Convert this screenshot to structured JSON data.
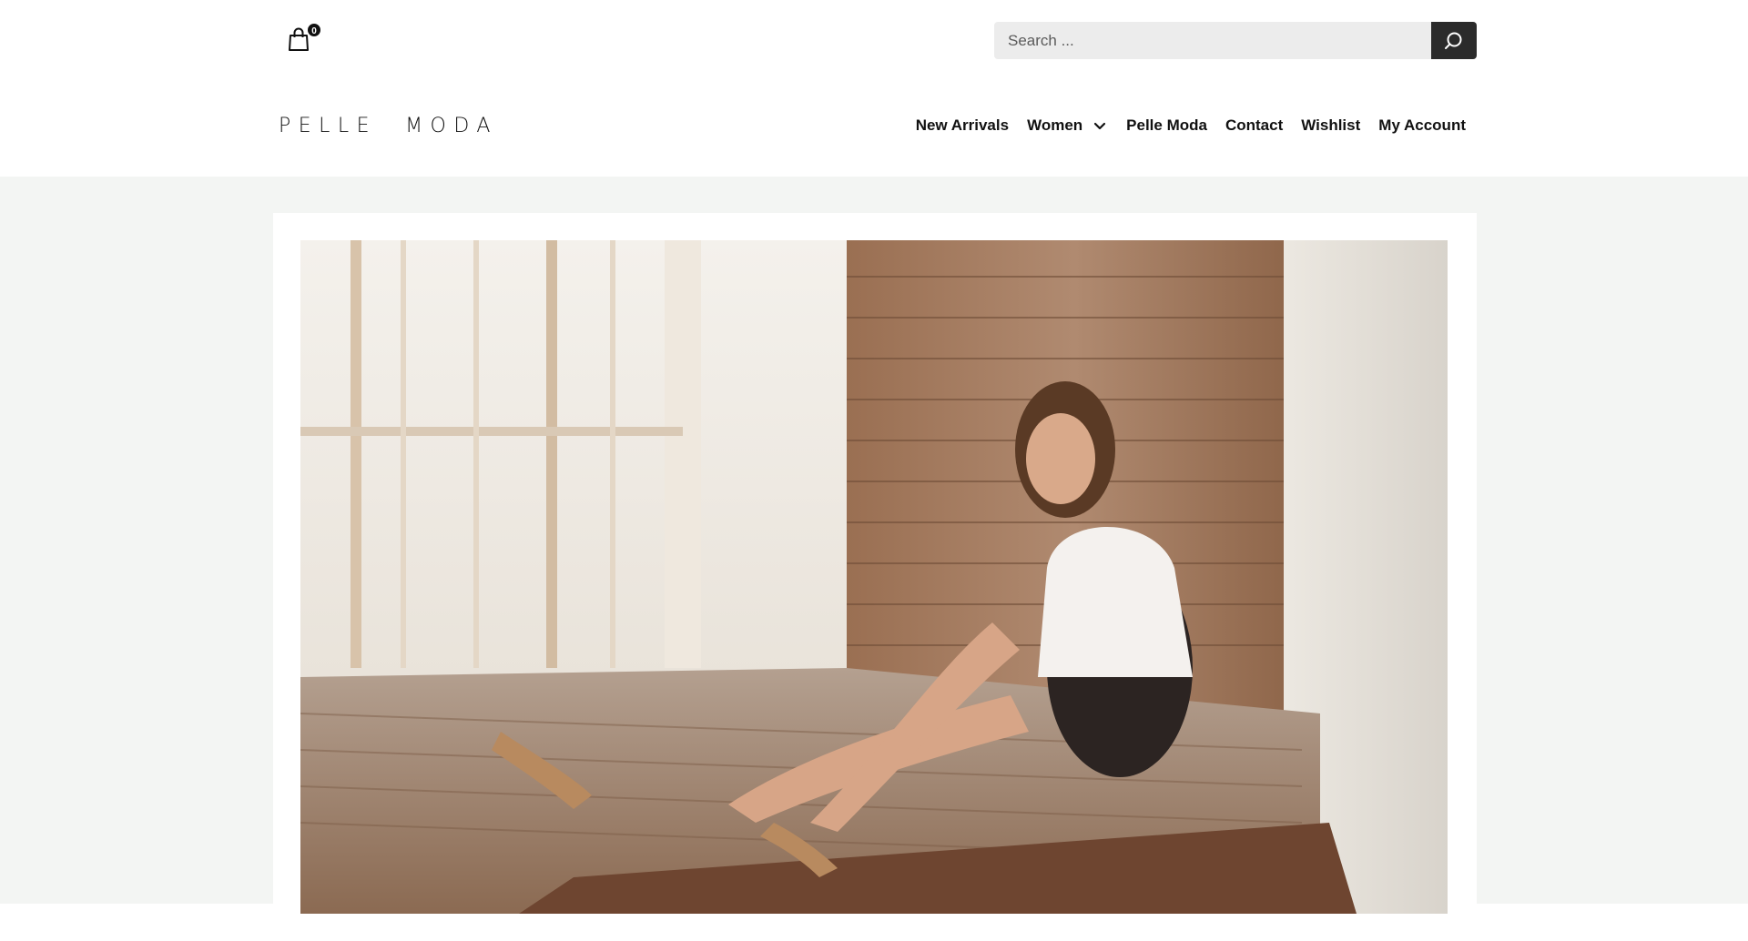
{
  "header": {
    "cart": {
      "count": "0"
    },
    "search": {
      "placeholder": "Search ..."
    },
    "logo": "PELLE  MODA",
    "nav": [
      {
        "label": "New Arrivals"
      },
      {
        "label": "Women",
        "has_dropdown": true
      },
      {
        "label": "Pelle Moda"
      },
      {
        "label": "Contact"
      },
      {
        "label": "Wishlist"
      },
      {
        "label": "My Account"
      }
    ]
  },
  "hero": {
    "description_icon": "photo-of-woman-seated-on-wooden-platform"
  },
  "colors": {
    "background": "#f3f5f3",
    "search_button": "#2b2b2b",
    "search_field": "#ececec"
  }
}
